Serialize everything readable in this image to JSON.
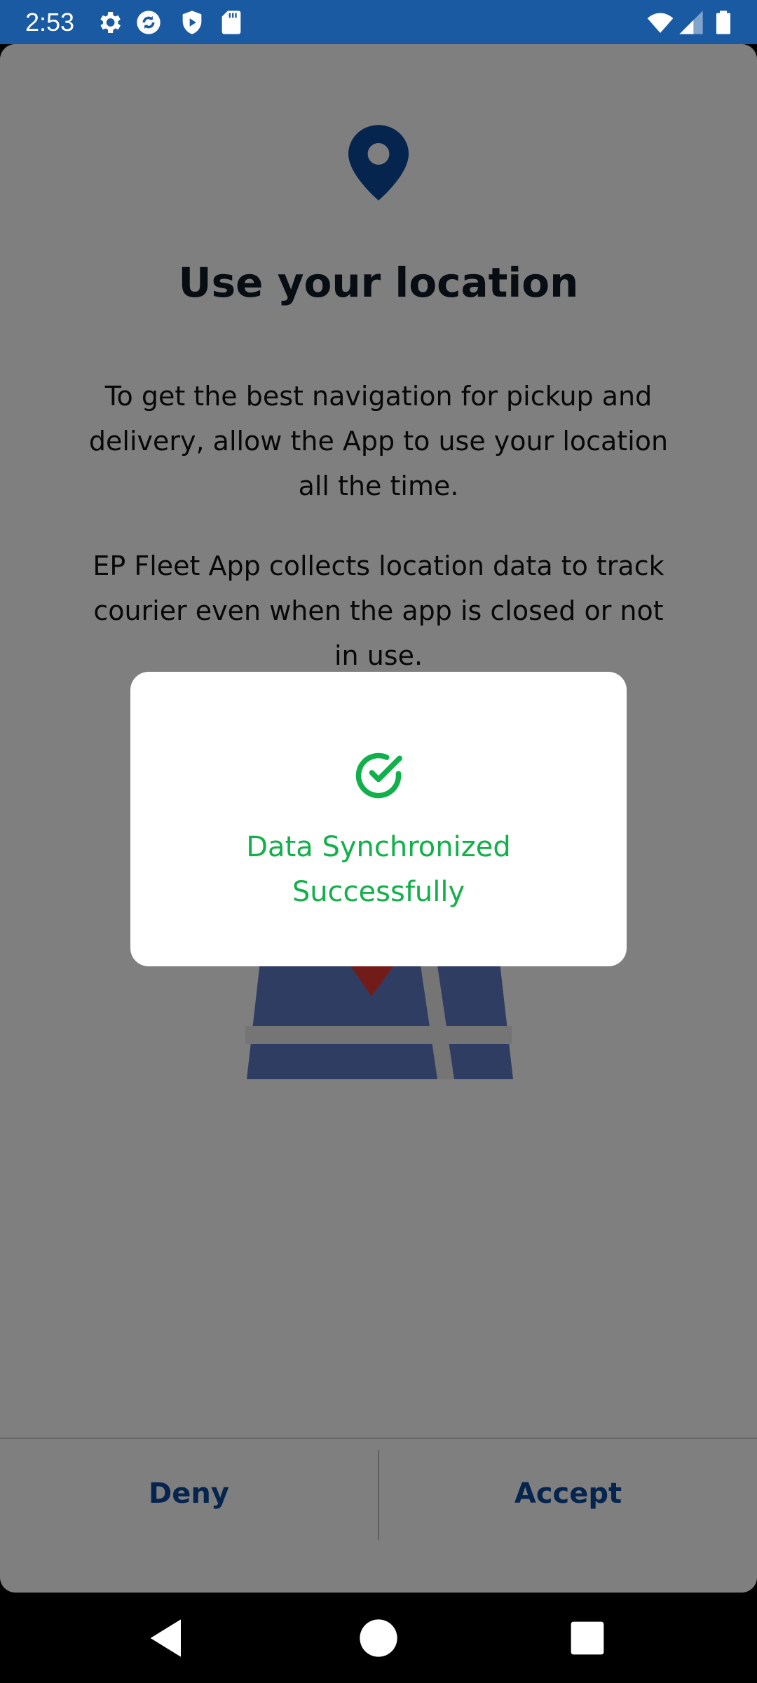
{
  "status_bar": {
    "time": "2:53",
    "background": "#1a5aa3",
    "icons": [
      "settings-icon",
      "sync-icon",
      "shield-play-icon",
      "sd-card-icon",
      "wifi-icon",
      "signal-icon",
      "battery-icon"
    ]
  },
  "permission": {
    "icon": "location-pin-icon",
    "title": "Use your location",
    "paragraph_1": "To get the best navigation for pickup and delivery, allow the App to use your location all the time.",
    "paragraph_2": "EP Fleet App collects location data to track courier even when the app is closed or not in use.",
    "deny_label": "Deny",
    "accept_label": "Accept",
    "accent_color": "#0a4a9c"
  },
  "dialog": {
    "icon": "check-circle-icon",
    "message": "Data Synchronized Successfully",
    "color": "#12b04a"
  },
  "nav_bar": {
    "buttons": [
      "back-icon",
      "home-icon",
      "recents-icon"
    ]
  }
}
